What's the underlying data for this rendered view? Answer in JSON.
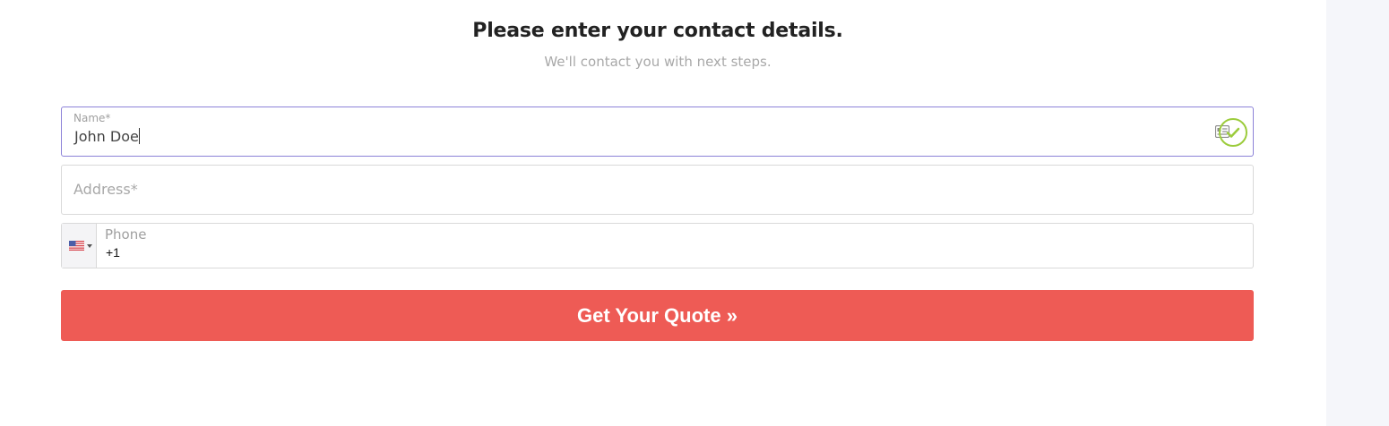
{
  "form": {
    "heading": "Please enter your contact details.",
    "subheading": "We'll contact you with next steps.",
    "name": {
      "label": "Name*",
      "value": "John Doe",
      "status": "valid"
    },
    "address": {
      "placeholder": "Address*",
      "value": ""
    },
    "phone": {
      "label": "Phone",
      "value": "+1",
      "country": "US",
      "country_flag_icon": "us-flag-icon"
    },
    "submit_label": "Get Your Quote »"
  },
  "colors": {
    "focus_border": "#8c82d8",
    "valid_check": "#9ccc3c",
    "button_bg": "#ee5b55",
    "button_text": "#ffffff",
    "heading_text": "#222222",
    "muted_text": "#a8a8a8"
  },
  "icons": {
    "name_field_autofill": "contact-card-icon",
    "name_field_valid": "check-circle-icon",
    "phone_dropdown": "caret-down-icon"
  }
}
